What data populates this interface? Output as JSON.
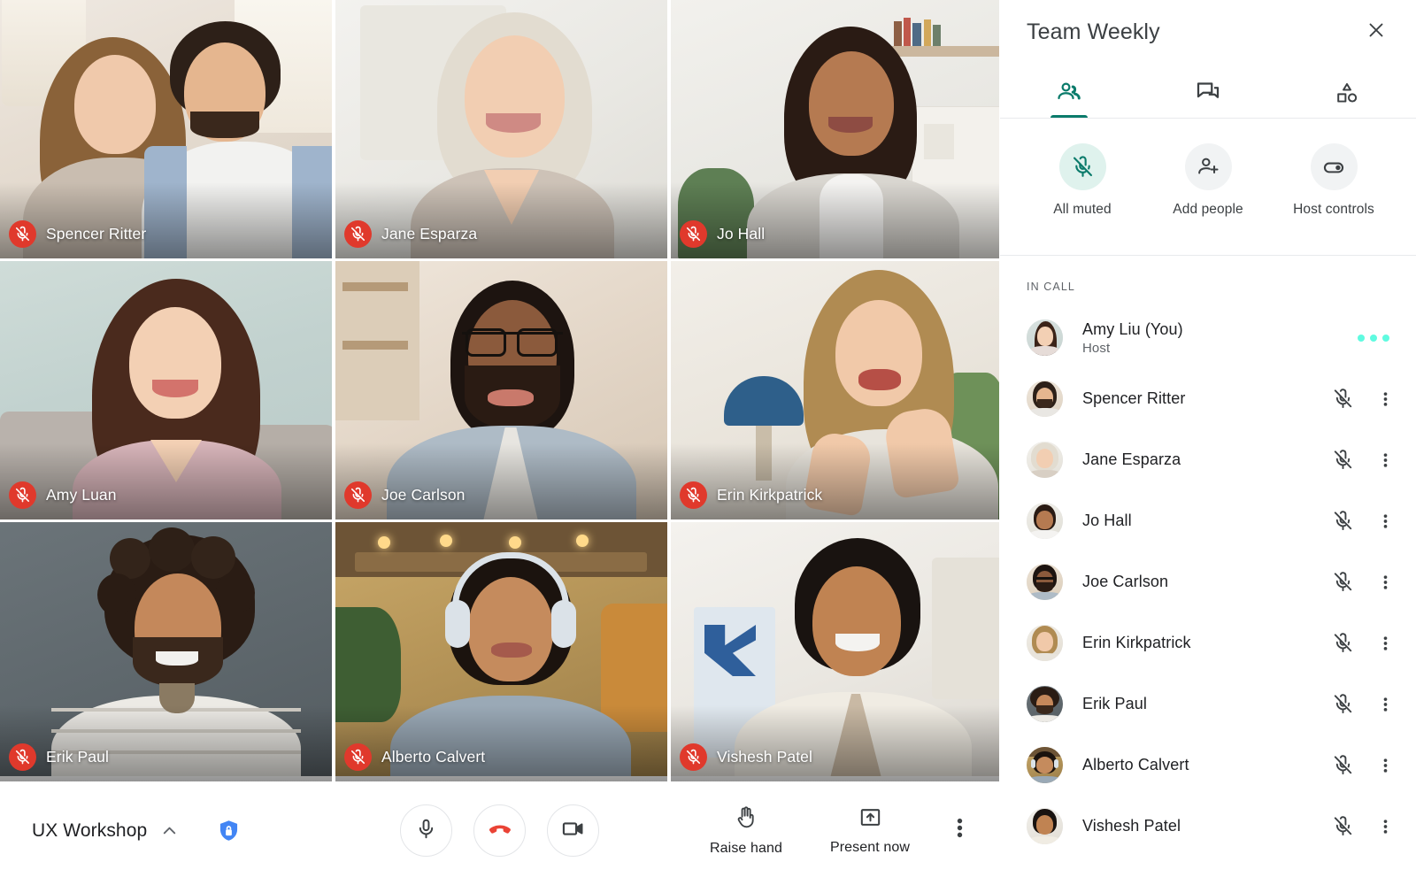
{
  "panel": {
    "title": "Team Weekly",
    "close_icon": "close-icon",
    "tabs": [
      {
        "id": "people",
        "icon": "people-icon",
        "active": true
      },
      {
        "id": "chat",
        "icon": "chat-icon",
        "active": false
      },
      {
        "id": "activities",
        "icon": "activities-icon",
        "active": false
      }
    ],
    "quick_actions": [
      {
        "id": "all-muted",
        "label": "All muted",
        "icon": "mic-off-icon",
        "highlighted": true
      },
      {
        "id": "add-people",
        "label": "Add people",
        "icon": "person-add-icon",
        "highlighted": false
      },
      {
        "id": "host-controls",
        "label": "Host controls",
        "icon": "toggle-icon",
        "highlighted": false
      }
    ],
    "section_label": "IN CALL",
    "participants": [
      {
        "name": "Amy Liu (You)",
        "role": "Host",
        "muted": false,
        "speaking": true,
        "kebab": false
      },
      {
        "name": "Spencer Ritter",
        "role": "",
        "muted": true,
        "speaking": false,
        "kebab": true
      },
      {
        "name": "Jane Esparza",
        "role": "",
        "muted": true,
        "speaking": false,
        "kebab": true
      },
      {
        "name": "Jo Hall",
        "role": "",
        "muted": true,
        "speaking": false,
        "kebab": true
      },
      {
        "name": "Joe Carlson",
        "role": "",
        "muted": true,
        "speaking": false,
        "kebab": true
      },
      {
        "name": "Erin Kirkpatrick",
        "role": "",
        "muted": true,
        "speaking": false,
        "kebab": true
      },
      {
        "name": "Erik Paul",
        "role": "",
        "muted": true,
        "speaking": false,
        "kebab": true
      },
      {
        "name": "Alberto Calvert",
        "role": "",
        "muted": true,
        "speaking": false,
        "kebab": true
      },
      {
        "name": "Vishesh Patel",
        "role": "",
        "muted": true,
        "speaking": false,
        "kebab": true
      }
    ]
  },
  "stage": {
    "tiles": [
      {
        "name": "Spencer Ritter",
        "muted": true
      },
      {
        "name": "Jane Esparza",
        "muted": true
      },
      {
        "name": "Jo Hall",
        "muted": true
      },
      {
        "name": "Amy Luan",
        "muted": true
      },
      {
        "name": "Joe Carlson",
        "muted": true
      },
      {
        "name": "Erin Kirkpatrick",
        "muted": true
      },
      {
        "name": "Erik Paul",
        "muted": true
      },
      {
        "name": "Alberto Calvert",
        "muted": true
      },
      {
        "name": "Vishesh Patel",
        "muted": true
      }
    ]
  },
  "controls": {
    "meeting_name": "UX Workshop",
    "expand_icon": "chevron-up-icon",
    "encryption_icon": "shield-lock-icon",
    "buttons": [
      {
        "id": "microphone",
        "icon": "microphone-icon"
      },
      {
        "id": "hangup",
        "icon": "call-end-icon"
      },
      {
        "id": "camera",
        "icon": "video-camera-icon"
      }
    ],
    "raise_hand_label": "Raise hand",
    "raise_hand_icon": "hand-icon",
    "present_now_label": "Present now",
    "present_now_icon": "present-screen-icon",
    "more_options_icon": "more-vertical-icon"
  },
  "colors": {
    "accent_green": "#0b7b6b",
    "mint": "#dff2ed",
    "mute_red": "#e0392c",
    "hangup_red": "#ea4335",
    "shield_blue": "#4285f4",
    "speaking_cyan": "#5ffbe0",
    "text_primary": "#202124",
    "text_secondary": "#5f6368"
  }
}
